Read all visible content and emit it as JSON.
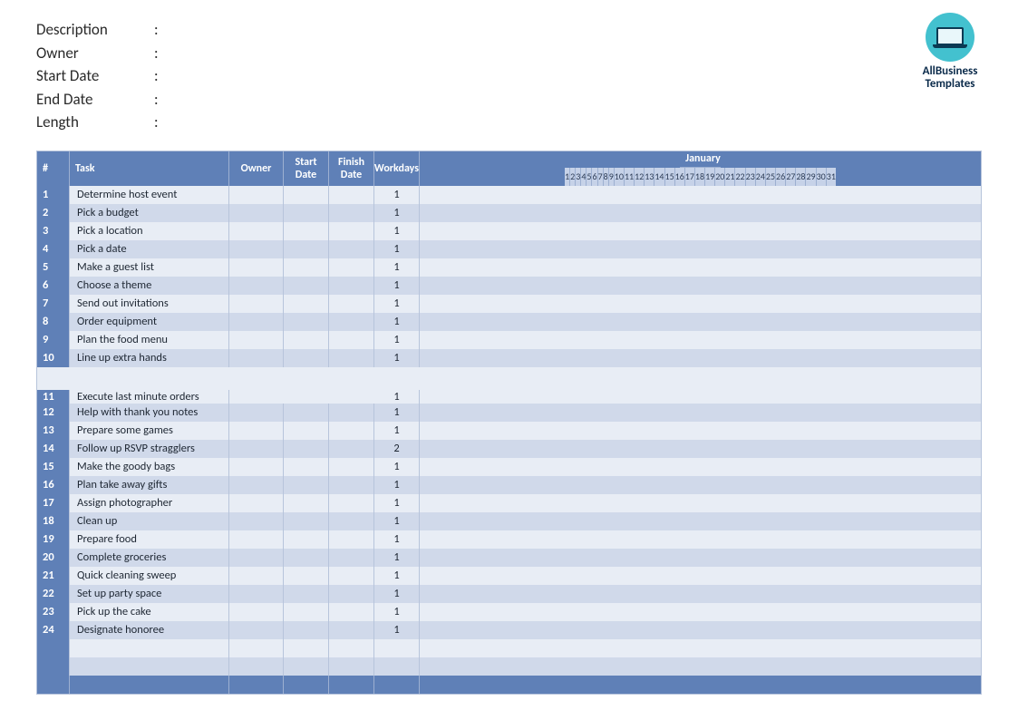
{
  "logo": {
    "line1": "AllBusiness",
    "line2": "Templates"
  },
  "meta": {
    "labels": {
      "description": "Description",
      "owner": "Owner",
      "start_date": "Start Date",
      "end_date": "End Date",
      "length": "Length"
    },
    "values": {
      "description": "",
      "owner": "",
      "start_date": "",
      "end_date": "",
      "length": ""
    }
  },
  "headers": {
    "num": "#",
    "task": "Task",
    "owner": "Owner",
    "start": "Start Date",
    "finish": "Finish Date",
    "work": "Workdays",
    "month": "January"
  },
  "days": [
    "1",
    "2",
    "3",
    "4",
    "5",
    "6",
    "7",
    "8",
    "9",
    "10",
    "11",
    "12",
    "13",
    "14",
    "15",
    "16",
    "17",
    "18",
    "19",
    "20",
    "21",
    "22",
    "23",
    "24",
    "25",
    "26",
    "27",
    "28",
    "29",
    "30",
    "31"
  ],
  "tasks": [
    {
      "n": "1",
      "task": "Determine host event",
      "owner": "",
      "start": "",
      "finish": "",
      "work": "1",
      "tall": false
    },
    {
      "n": "2",
      "task": "Pick a budget",
      "owner": "",
      "start": "",
      "finish": "",
      "work": "1",
      "tall": false
    },
    {
      "n": "3",
      "task": "Pick a location",
      "owner": "",
      "start": "",
      "finish": "",
      "work": "1",
      "tall": false
    },
    {
      "n": "4",
      "task": "Pick a date",
      "owner": "",
      "start": "",
      "finish": "",
      "work": "1",
      "tall": false
    },
    {
      "n": "5",
      "task": "Make a guest list",
      "owner": "",
      "start": "",
      "finish": "",
      "work": "1",
      "tall": false
    },
    {
      "n": "6",
      "task": "Choose a theme",
      "owner": "",
      "start": "",
      "finish": "",
      "work": "1",
      "tall": false
    },
    {
      "n": "7",
      "task": "Send out invitations",
      "owner": "",
      "start": "",
      "finish": "",
      "work": "1",
      "tall": false
    },
    {
      "n": "8",
      "task": "Order equipment",
      "owner": "",
      "start": "",
      "finish": "",
      "work": "1",
      "tall": false
    },
    {
      "n": "9",
      "task": "Plan the food menu",
      "owner": "",
      "start": "",
      "finish": "",
      "work": "1",
      "tall": false
    },
    {
      "n": "10",
      "task": "Line up extra hands",
      "owner": "",
      "start": "",
      "finish": "",
      "work": "1",
      "tall": false
    },
    {
      "n": "11",
      "task": "Execute last minute orders",
      "owner": "",
      "start": "",
      "finish": "",
      "work": "1",
      "tall": true
    },
    {
      "n": "12",
      "task": "Help with thank you notes",
      "owner": "",
      "start": "",
      "finish": "",
      "work": "1",
      "tall": false
    },
    {
      "n": "13",
      "task": "Prepare some games",
      "owner": "",
      "start": "",
      "finish": "",
      "work": "1",
      "tall": false
    },
    {
      "n": "14",
      "task": "Follow up RSVP stragglers",
      "owner": "",
      "start": "",
      "finish": "",
      "work": "2",
      "tall": false
    },
    {
      "n": "15",
      "task": "Make the goody bags",
      "owner": "",
      "start": "",
      "finish": "",
      "work": "1",
      "tall": false
    },
    {
      "n": "16",
      "task": "Plan take away gifts",
      "owner": "",
      "start": "",
      "finish": "",
      "work": "1",
      "tall": false
    },
    {
      "n": "17",
      "task": "Assign photographer",
      "owner": "",
      "start": "",
      "finish": "",
      "work": "1",
      "tall": false
    },
    {
      "n": "18",
      "task": "Clean up",
      "owner": "",
      "start": "",
      "finish": "",
      "work": "1",
      "tall": false
    },
    {
      "n": "19",
      "task": "Prepare food",
      "owner": "",
      "start": "",
      "finish": "",
      "work": "1",
      "tall": false
    },
    {
      "n": "20",
      "task": "Complete groceries",
      "owner": "",
      "start": "",
      "finish": "",
      "work": "1",
      "tall": false
    },
    {
      "n": "21",
      "task": "Quick cleaning sweep",
      "owner": "",
      "start": "",
      "finish": "",
      "work": "1",
      "tall": false
    },
    {
      "n": "22",
      "task": "Set up party space",
      "owner": "",
      "start": "",
      "finish": "",
      "work": "1",
      "tall": false
    },
    {
      "n": "23",
      "task": "Pick up the cake",
      "owner": "",
      "start": "",
      "finish": "",
      "work": "1",
      "tall": false
    },
    {
      "n": "24",
      "task": "Designate honoree",
      "owner": "",
      "start": "",
      "finish": "",
      "work": "1",
      "tall": false
    }
  ],
  "empty_rows_after": 2
}
